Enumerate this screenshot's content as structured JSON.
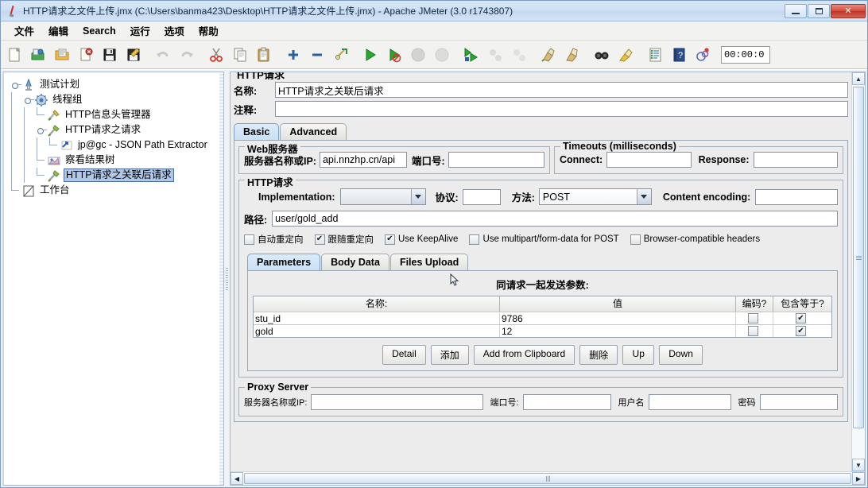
{
  "window": {
    "title": "HTTP请求之文件上传.jmx (C:\\Users\\banma423\\Desktop\\HTTP请求之文件上传.jmx) - Apache JMeter (3.0 r1743807)",
    "icon": "jmeter-feather-icon",
    "minimize_label": "",
    "maximize_label": "",
    "close_label": "✕"
  },
  "menu": {
    "items": [
      "文件",
      "编辑",
      "Search",
      "运行",
      "选项",
      "帮助"
    ]
  },
  "toolbar": {
    "buttons": [
      {
        "name": "new-icon",
        "title": "New"
      },
      {
        "name": "templates-icon",
        "title": "Templates"
      },
      {
        "name": "open-icon",
        "title": "Open"
      },
      {
        "name": "close-icon",
        "title": "Close"
      },
      {
        "name": "save-icon",
        "title": "Save"
      },
      {
        "name": "save-as-icon",
        "title": "Save As"
      },
      {
        "name": "undo-icon",
        "title": "Undo"
      },
      {
        "name": "redo-icon",
        "title": "Redo"
      },
      {
        "name": "cut-icon",
        "title": "Cut"
      },
      {
        "name": "copy-icon",
        "title": "Copy"
      },
      {
        "name": "paste-icon",
        "title": "Paste"
      },
      {
        "name": "expand-all-icon",
        "title": "Expand All"
      },
      {
        "name": "collapse-all-icon",
        "title": "Collapse All"
      },
      {
        "name": "toggle-icon",
        "title": "Toggle"
      },
      {
        "name": "start-icon",
        "title": "Start"
      },
      {
        "name": "start-no-timers-icon",
        "title": "Start no pauses"
      },
      {
        "name": "stop-icon",
        "title": "Stop"
      },
      {
        "name": "shutdown-icon",
        "title": "Shutdown"
      },
      {
        "name": "start-remote-icon",
        "title": "Remote Start All"
      },
      {
        "name": "stop-remote-icon",
        "title": "Remote Stop All"
      },
      {
        "name": "shutdown-remote-icon",
        "title": "Remote Shutdown All"
      },
      {
        "name": "clear-icon",
        "title": "Clear"
      },
      {
        "name": "clear-all-icon",
        "title": "Clear All"
      },
      {
        "name": "search-icon",
        "title": "Search"
      },
      {
        "name": "search-reset-icon",
        "title": "Reset Search"
      },
      {
        "name": "function-helper-icon",
        "title": "Function Helper Dialog"
      },
      {
        "name": "help-icon",
        "title": "Help"
      },
      {
        "name": "thread-status-icon",
        "title": "Threads"
      }
    ],
    "timer_value": "00:00:0"
  },
  "tree": {
    "nodes": [
      {
        "label": "测试计划",
        "icon": "test-plan-icon",
        "depth": 0,
        "expanded": true,
        "selected": false
      },
      {
        "label": "线程组",
        "icon": "thread-group-icon",
        "depth": 1,
        "expanded": true,
        "selected": false
      },
      {
        "label": "HTTP信息头管理器",
        "icon": "header-manager-icon",
        "depth": 2,
        "expanded": false,
        "selected": false
      },
      {
        "label": "HTTP请求之请求",
        "icon": "http-request-icon",
        "depth": 2,
        "expanded": true,
        "selected": false
      },
      {
        "label": "jp@gc - JSON Path Extractor",
        "icon": "json-path-extractor-icon",
        "depth": 3,
        "expanded": false,
        "selected": false
      },
      {
        "label": "察看结果树",
        "icon": "view-results-tree-icon",
        "depth": 2,
        "expanded": false,
        "selected": false
      },
      {
        "label": "HTTP请求之关联后请求",
        "icon": "http-request-icon",
        "depth": 2,
        "expanded": false,
        "selected": true
      },
      {
        "label": "工作台",
        "icon": "workbench-icon",
        "depth": 0,
        "expanded": false,
        "selected": false
      }
    ]
  },
  "editor": {
    "clipped_header": "HTTP请求",
    "name_label": "名称:",
    "name_value": "HTTP请求之关联后请求",
    "comment_label": "注释:",
    "comment_value": "",
    "tabs": [
      {
        "label": "Basic",
        "active": true
      },
      {
        "label": "Advanced",
        "active": false
      }
    ],
    "web_server": {
      "title": "Web服务器",
      "server_label": "服务器名称或IP:",
      "server_value": "api.nnzhp.cn/api",
      "port_label": "端口号:",
      "port_value": ""
    },
    "timeouts": {
      "title": "Timeouts (milliseconds)",
      "connect_label": "Connect:",
      "connect_value": "",
      "response_label": "Response:",
      "response_value": ""
    },
    "http_request": {
      "title": "HTTP请求",
      "implementation_label": "Implementation:",
      "implementation_value": "",
      "protocol_label": "协议:",
      "protocol_value": "",
      "method_label": "方法:",
      "method_value": "POST",
      "content_encoding_label": "Content encoding:",
      "content_encoding_value": "",
      "path_label": "路径:",
      "path_value": "user/gold_add",
      "checkboxes": [
        {
          "label": "自动重定向",
          "checked": false
        },
        {
          "label": "跟随重定向",
          "checked": true
        },
        {
          "label": "Use KeepAlive",
          "checked": true
        },
        {
          "label": "Use multipart/form-data for POST",
          "checked": false
        },
        {
          "label": "Browser-compatible headers",
          "checked": false
        }
      ]
    },
    "param_tabs": [
      {
        "label": "Parameters",
        "active": true
      },
      {
        "label": "Body Data",
        "active": false
      },
      {
        "label": "Files Upload",
        "active": false
      }
    ],
    "params_caption": "同请求一起发送参数:",
    "params_table": {
      "columns": [
        "名称:",
        "值",
        "编码?",
        "包含等于?"
      ],
      "rows": [
        {
          "name": "stu_id",
          "value": "9786",
          "encode": false,
          "include_equals": true
        },
        {
          "name": "gold",
          "value": "12",
          "encode": false,
          "include_equals": true
        }
      ]
    },
    "param_buttons": [
      "Detail",
      "添加",
      "Add from Clipboard",
      "删除",
      "Up",
      "Down"
    ],
    "proxy_server": {
      "title": "Proxy Server",
      "server_label": "服务器名称或IP:",
      "server_value": "",
      "port_label": "端口号:",
      "port_value": "",
      "user_label": "用户名",
      "user_value": "",
      "password_label": "密码",
      "password_value": ""
    }
  },
  "colors": {
    "accent": "#c9e0f6",
    "selection": "#b0c8e8",
    "panel": "#ececec",
    "titlebar": "#cfe0f4"
  }
}
